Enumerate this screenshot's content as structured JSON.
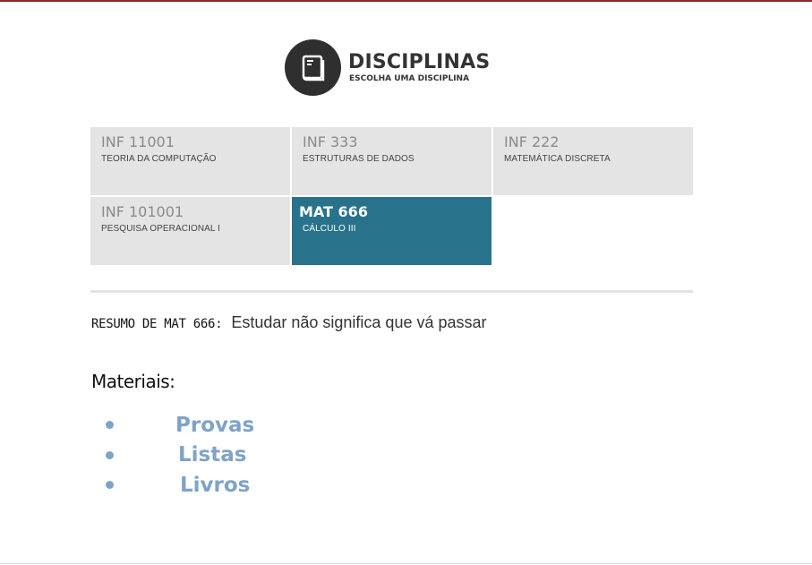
{
  "header": {
    "title": "DISCIPLINAS",
    "subtitle": "ESCOLHA UMA DISCIPLINA",
    "icon": "book-icon"
  },
  "courses": [
    {
      "code": "INF 11001",
      "name": "TEORIA DA COMPUTAÇÃO",
      "selected": false
    },
    {
      "code": "INF 333",
      "name": "ESTRUTURAS DE DADOS",
      "selected": false
    },
    {
      "code": "INF 222",
      "name": "MATEMÁTICA DISCRETA",
      "selected": false
    },
    {
      "code": "INF 101001",
      "name": "PESQUISA OPERACIONAL I",
      "selected": false
    },
    {
      "code": "MAT 666",
      "name": "CÁLCULO III",
      "selected": true
    }
  ],
  "summary": {
    "label": "RESUMO DE MAT 666:",
    "text": "Estudar não significa que vá passar"
  },
  "materials": {
    "title": "Materiais:",
    "items": [
      "Provas",
      "Listas",
      "Livros"
    ]
  },
  "colors": {
    "top_bar": "#8b2a2a",
    "tile_bg": "#e4e4e4",
    "tile_active": "#28728c",
    "link": "#7fa3c8"
  }
}
